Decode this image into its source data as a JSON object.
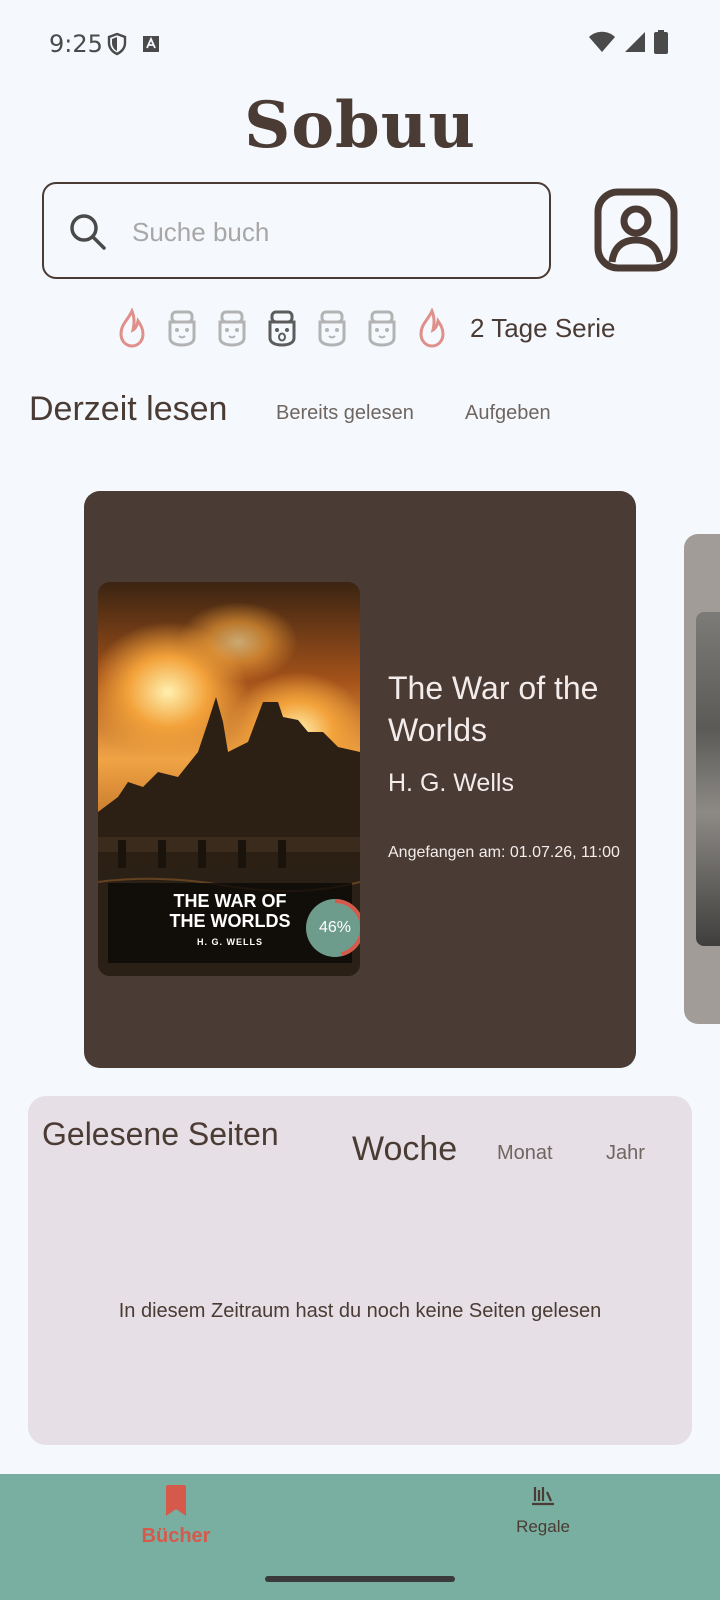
{
  "status_bar": {
    "time": "9:25",
    "left_icons": [
      "shield-icon",
      "font-icon"
    ],
    "right_icons": [
      "wifi-icon",
      "signal-icon",
      "battery-icon"
    ]
  },
  "app": {
    "title": "Sobuu"
  },
  "search": {
    "placeholder": "Suche buch",
    "value": ""
  },
  "streak": {
    "days": [
      "flame",
      "cup",
      "cup",
      "cup-today",
      "cup",
      "cup",
      "flame"
    ],
    "label": "2 Tage Serie"
  },
  "tabs": {
    "current": "Derzeit lesen",
    "read": "Bereits gelesen",
    "quit": "Aufgeben"
  },
  "current_book": {
    "title": "The War of the Worlds",
    "author": "H. G. Wells",
    "started": "Angefangen am: 01.07.26, 11:00",
    "cover_title": "THE WAR OF\nTHE WORLDS",
    "cover_author": "H. G. WELLS",
    "progress_label": "46%",
    "progress": 0.46
  },
  "stats": {
    "title": "Gelesene Seiten",
    "periods": {
      "week": "Woche",
      "month": "Monat",
      "year": "Jahr"
    },
    "empty_message": "In diesem Zeitraum hast du noch keine Seiten gelesen"
  },
  "bottom_nav": {
    "books": "Bücher",
    "shelves": "Regale"
  },
  "colors": {
    "primary_brown": "#4a3b34",
    "accent_red": "#d65a4c",
    "nav_green": "#79afa1",
    "stats_bg": "#e6dfe5",
    "progress_badge": "#6e9c8c"
  }
}
